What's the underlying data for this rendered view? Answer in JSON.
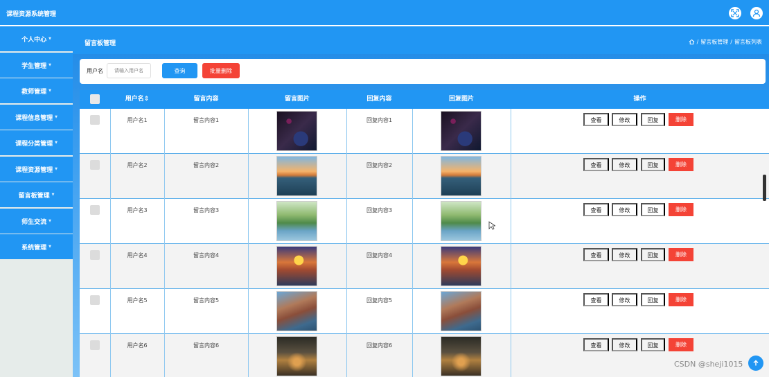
{
  "app": {
    "title": "课程资源系统管理"
  },
  "sidebar": {
    "items": [
      {
        "label": "个人中心"
      },
      {
        "label": "学生管理"
      },
      {
        "label": "教师管理"
      },
      {
        "label": "课程信息管理"
      },
      {
        "label": "课程分类管理"
      },
      {
        "label": "课程资源管理"
      },
      {
        "label": "留言板管理"
      },
      {
        "label": "师生交流"
      },
      {
        "label": "系统管理"
      }
    ]
  },
  "header": {
    "page_title": "留言板管理",
    "breadcrumb": [
      "留言板管理",
      "留言板列表"
    ]
  },
  "search": {
    "label": "用户名",
    "placeholder": "请输入用户名",
    "search_button": "查询",
    "batch_delete_button": "批量删除"
  },
  "table": {
    "headers": [
      "用户名",
      "留言内容",
      "留言图片",
      "回复内容",
      "回复图片",
      "操作"
    ],
    "sort_glyph": "⇕",
    "rows": [
      {
        "username": "用户名1",
        "message": "留言内容1",
        "reply": "回复内容1",
        "image": "t1"
      },
      {
        "username": "用户名2",
        "message": "留言内容2",
        "reply": "回复内容2",
        "image": "t2"
      },
      {
        "username": "用户名3",
        "message": "留言内容3",
        "reply": "回复内容3",
        "image": "t3"
      },
      {
        "username": "用户名4",
        "message": "留言内容4",
        "reply": "回复内容4",
        "image": "t4"
      },
      {
        "username": "用户名5",
        "message": "留言内容5",
        "reply": "回复内容5",
        "image": "t5"
      },
      {
        "username": "用户名6",
        "message": "留言内容6",
        "reply": "回复内容6",
        "image": "t6"
      }
    ],
    "actions": {
      "view": "查看",
      "edit": "修改",
      "reply": "回复",
      "delete": "删除"
    }
  },
  "watermark": "CSDN @sheji1015",
  "colors": {
    "primary": "#2196f3",
    "danger": "#f44336",
    "sidebar_bg": "#e6ecea"
  },
  "icons": {
    "fullscreen": "fullscreen-icon",
    "user": "user-icon",
    "home": "home-icon",
    "cursor": "cursor-icon"
  }
}
